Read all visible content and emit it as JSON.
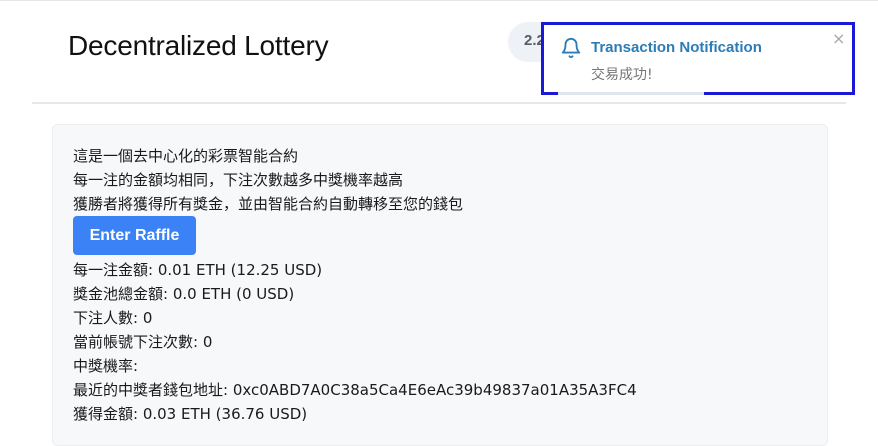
{
  "header": {
    "title": "Decentralized Lottery",
    "wallet_pill_partial": "2.2"
  },
  "panel": {
    "intro_lines": [
      "這是一個去中心化的彩票智能合約",
      "每一注的金額均相同，下注次數越多中獎機率越高",
      "獲勝者將獲得所有獎金，並由智能合約自動轉移至您的錢包"
    ],
    "enter_button_label": "Enter Raffle",
    "stats": [
      "每一注金額: 0.01 ETH (12.25 USD)",
      "獎金池總金額: 0.0 ETH (0 USD)",
      "下注人數: 0",
      "當前帳號下注次數: 0",
      "中獎機率:",
      "最近的中獎者錢包地址: 0xc0ABD7A0C38a5Ca4E6eAc39b49837a01A35A3FC4",
      "獲得金額: 0.03 ETH (36.76 USD)"
    ]
  },
  "notification": {
    "title": "Transaction Notification",
    "message": "交易成功!",
    "close_glyph": "×",
    "icon": "bell-icon",
    "highlight_color": "#1a19d8",
    "title_color": "#2b7cb7"
  },
  "colors": {
    "primary_button": "#3b82f6",
    "panel_background": "#f7f8fa"
  }
}
